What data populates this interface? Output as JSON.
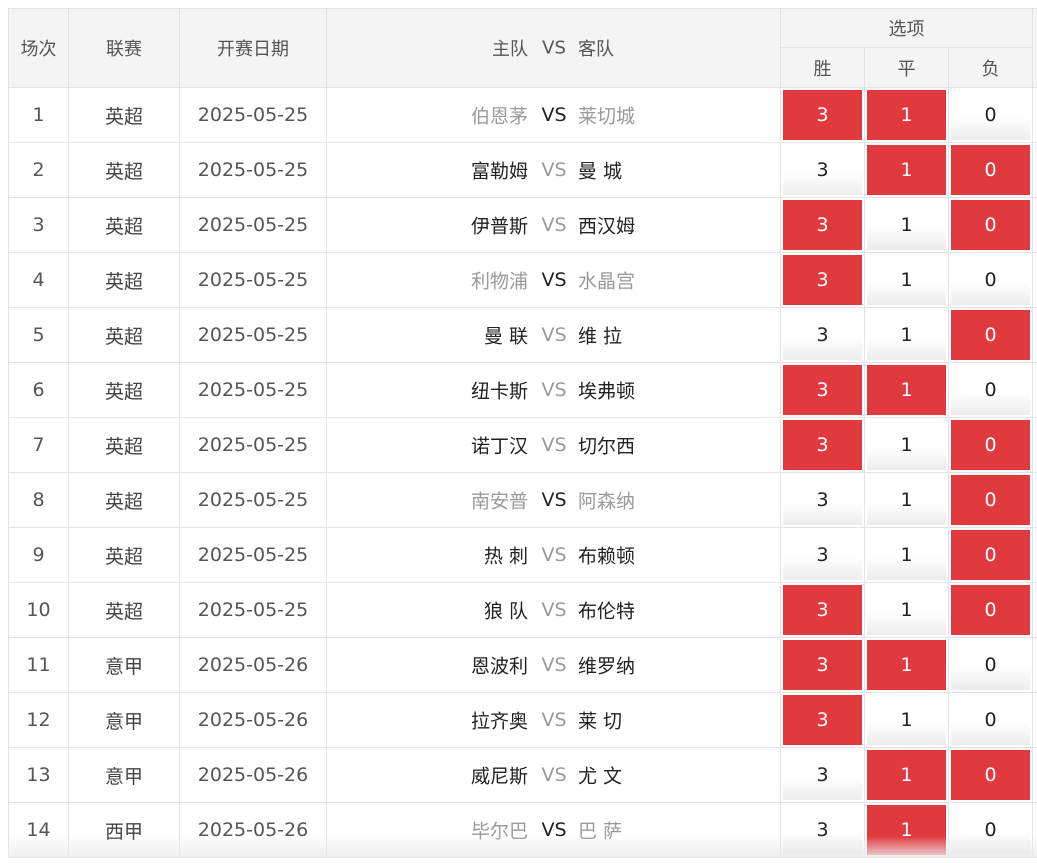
{
  "colors": {
    "selected": "#e0393e",
    "header_bg": "#f4f4f4",
    "border": "#e3e3e3"
  },
  "header": {
    "col_round": "场次",
    "col_league": "联赛",
    "col_date": "开赛日期",
    "col_home": "主队",
    "col_vs": "VS",
    "col_away": "客队",
    "col_options": "选项",
    "opt_win": "胜",
    "opt_draw": "平",
    "opt_lose": "负"
  },
  "matches": [
    {
      "num": "1",
      "league": "英超",
      "date": "2025-05-25",
      "home": "伯恩茅",
      "away": "莱切城",
      "vs": "VS",
      "dim": true,
      "opts": [
        "3",
        "1",
        "0"
      ],
      "sel": [
        true,
        true,
        false
      ]
    },
    {
      "num": "2",
      "league": "英超",
      "date": "2025-05-25",
      "home": "富勒姆",
      "away": "曼 城",
      "vs": "VS",
      "dim": false,
      "opts": [
        "3",
        "1",
        "0"
      ],
      "sel": [
        false,
        true,
        true
      ]
    },
    {
      "num": "3",
      "league": "英超",
      "date": "2025-05-25",
      "home": "伊普斯",
      "away": "西汉姆",
      "vs": "VS",
      "dim": false,
      "opts": [
        "3",
        "1",
        "0"
      ],
      "sel": [
        true,
        false,
        true
      ]
    },
    {
      "num": "4",
      "league": "英超",
      "date": "2025-05-25",
      "home": "利物浦",
      "away": "水晶宫",
      "vs": "VS",
      "dim": true,
      "opts": [
        "3",
        "1",
        "0"
      ],
      "sel": [
        true,
        false,
        false
      ]
    },
    {
      "num": "5",
      "league": "英超",
      "date": "2025-05-25",
      "home": "曼 联",
      "away": "维 拉",
      "vs": "VS",
      "dim": false,
      "opts": [
        "3",
        "1",
        "0"
      ],
      "sel": [
        false,
        false,
        true
      ]
    },
    {
      "num": "6",
      "league": "英超",
      "date": "2025-05-25",
      "home": "纽卡斯",
      "away": "埃弗顿",
      "vs": "VS",
      "dim": false,
      "opts": [
        "3",
        "1",
        "0"
      ],
      "sel": [
        true,
        true,
        false
      ]
    },
    {
      "num": "7",
      "league": "英超",
      "date": "2025-05-25",
      "home": "诺丁汉",
      "away": "切尔西",
      "vs": "VS",
      "dim": false,
      "opts": [
        "3",
        "1",
        "0"
      ],
      "sel": [
        true,
        false,
        true
      ]
    },
    {
      "num": "8",
      "league": "英超",
      "date": "2025-05-25",
      "home": "南安普",
      "away": "阿森纳",
      "vs": "VS",
      "dim": true,
      "opts": [
        "3",
        "1",
        "0"
      ],
      "sel": [
        false,
        false,
        true
      ]
    },
    {
      "num": "9",
      "league": "英超",
      "date": "2025-05-25",
      "home": "热 刺",
      "away": "布赖顿",
      "vs": "VS",
      "dim": false,
      "opts": [
        "3",
        "1",
        "0"
      ],
      "sel": [
        false,
        false,
        true
      ]
    },
    {
      "num": "10",
      "league": "英超",
      "date": "2025-05-25",
      "home": "狼 队",
      "away": "布伦特",
      "vs": "VS",
      "dim": false,
      "opts": [
        "3",
        "1",
        "0"
      ],
      "sel": [
        true,
        false,
        true
      ]
    },
    {
      "num": "11",
      "league": "意甲",
      "date": "2025-05-26",
      "home": "恩波利",
      "away": "维罗纳",
      "vs": "VS",
      "dim": false,
      "opts": [
        "3",
        "1",
        "0"
      ],
      "sel": [
        true,
        true,
        false
      ]
    },
    {
      "num": "12",
      "league": "意甲",
      "date": "2025-05-26",
      "home": "拉齐奥",
      "away": "莱 切",
      "vs": "VS",
      "dim": false,
      "opts": [
        "3",
        "1",
        "0"
      ],
      "sel": [
        true,
        false,
        false
      ]
    },
    {
      "num": "13",
      "league": "意甲",
      "date": "2025-05-26",
      "home": "威尼斯",
      "away": "尤 文",
      "vs": "VS",
      "dim": false,
      "opts": [
        "3",
        "1",
        "0"
      ],
      "sel": [
        false,
        true,
        true
      ]
    },
    {
      "num": "14",
      "league": "西甲",
      "date": "2025-05-26",
      "home": "毕尔巴",
      "away": "巴 萨",
      "vs": "VS",
      "dim": true,
      "opts": [
        "3",
        "1",
        "0"
      ],
      "sel": [
        false,
        true,
        false
      ]
    }
  ]
}
